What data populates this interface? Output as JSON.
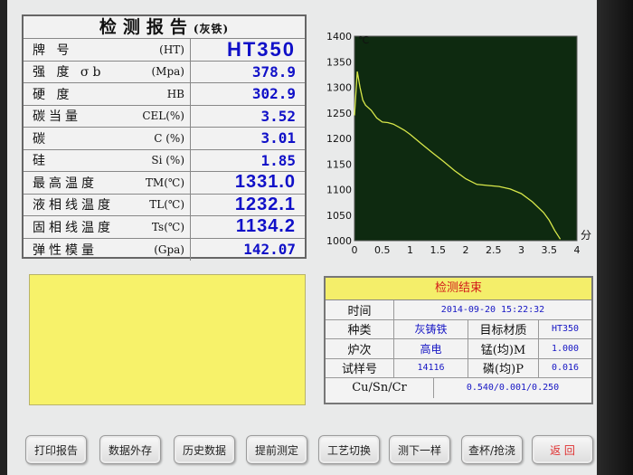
{
  "report": {
    "title": "检测报告",
    "title_sub": "(灰铁)",
    "rows": [
      {
        "name": "牌   号",
        "unit": "(HT)",
        "value": "HT350"
      },
      {
        "name": "强 度  σb",
        "unit": "(Mpa)",
        "value": "378.9"
      },
      {
        "name": "硬   度",
        "unit": "HB",
        "value": "302.9"
      },
      {
        "name": "碳当量",
        "unit": "CEL(%)",
        "value": "3.52"
      },
      {
        "name": "碳",
        "unit": "C  (%)",
        "value": "3.01"
      },
      {
        "name": "硅",
        "unit": "Si  (%)",
        "value": "1.85"
      },
      {
        "name": "最高温度",
        "unit": "TM(℃)",
        "value": "1331.0"
      },
      {
        "name": "液相线温度",
        "unit": "TL(℃)",
        "value": "1232.1"
      },
      {
        "name": "固相线温度",
        "unit": "Ts(℃)",
        "value": "1134.2"
      },
      {
        "name": "弹性模量",
        "unit": "(Gpa)",
        "value": "142.07"
      }
    ]
  },
  "chart_data": {
    "type": "line",
    "title": "",
    "ylabel": "℃",
    "xlabel": "分",
    "xlim": [
      0,
      4
    ],
    "ylim": [
      1000,
      1400
    ],
    "xticks": [
      "0",
      "0.5",
      "1",
      "1.5",
      "2",
      "2.5",
      "3",
      "3.5",
      "4"
    ],
    "yticks": [
      "1000",
      "1050",
      "1100",
      "1150",
      "1200",
      "1250",
      "1300",
      "1350",
      "1400"
    ],
    "background": "#0e2a10",
    "line_color": "#d8e84a",
    "grid": false,
    "series": [
      {
        "x": [
          0.0,
          0.05,
          0.1,
          0.15,
          0.2,
          0.3,
          0.4,
          0.5,
          0.6,
          0.7,
          0.8,
          0.9,
          1.0,
          1.2,
          1.4,
          1.6,
          1.8,
          2.0,
          2.2,
          2.4,
          2.6,
          2.8,
          3.0,
          3.2,
          3.4,
          3.5,
          3.6,
          3.7
        ],
        "y": [
          1245,
          1331,
          1300,
          1275,
          1265,
          1255,
          1240,
          1232,
          1231,
          1228,
          1222,
          1216,
          1208,
          1190,
          1172,
          1155,
          1137,
          1121,
          1110,
          1108,
          1106,
          1101,
          1092,
          1076,
          1055,
          1040,
          1020,
          1003
        ]
      }
    ]
  },
  "status": {
    "label": "检测结束"
  },
  "result": {
    "time_label": "时间",
    "time_value": "2014-09-20 15:22:32",
    "type_label": "种类",
    "type_value": "灰铸铁",
    "target_label": "目标材质",
    "target_value": "HT350",
    "furnace_label": "炉次",
    "furnace_value": "高电",
    "mn_label": "锰(均)M",
    "mn_value": "1.000",
    "sample_label": "试样号",
    "sample_value": "14116",
    "p_label": "磷(均)P",
    "p_value": "0.016",
    "cu_label": "Cu/Sn/Cr",
    "cu_value": "0.540/0.001/0.250"
  },
  "buttons": [
    {
      "label": "打印报告"
    },
    {
      "label": "数据外存"
    },
    {
      "label": "历史数据"
    },
    {
      "label": "提前测定"
    },
    {
      "label": "工艺切换"
    },
    {
      "label": "测下一样"
    },
    {
      "label": "查杯/抢浇"
    },
    {
      "label": "返 回"
    }
  ],
  "colors": {
    "value_blue": "#1010c8",
    "panel_yellow": "#f7f26a",
    "status_red": "#d21b1b",
    "return_red": "#e03030"
  }
}
